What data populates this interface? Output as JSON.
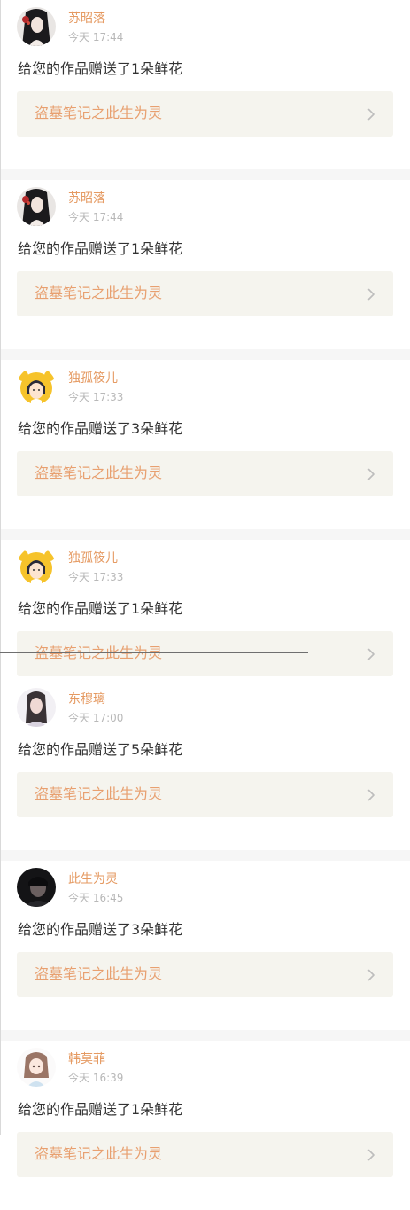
{
  "notifications": [
    {
      "user": "苏昭落",
      "time": "今天 17:44",
      "message": "给您的作品赠送了1朵鲜花",
      "work_title": "盗墓笔记之此生为灵",
      "avatar_icon": "avatar-icon-ink-portrait-woman"
    },
    {
      "user": "苏昭落",
      "time": "今天 17:44",
      "message": "给您的作品赠送了1朵鲜花",
      "work_title": "盗墓笔记之此生为灵",
      "avatar_icon": "avatar-icon-ink-portrait-woman"
    },
    {
      "user": "独孤筱儿",
      "time": "今天 17:33",
      "message": "给您的作品赠送了3朵鲜花",
      "work_title": "盗墓笔记之此生为灵",
      "avatar_icon": "avatar-icon-cartoon-girl-yellow"
    },
    {
      "user": "独孤筱儿",
      "time": "今天 17:33",
      "message": "给您的作品赠送了1朵鲜花",
      "work_title": "盗墓笔记之此生为灵",
      "avatar_icon": "avatar-icon-cartoon-girl-yellow"
    },
    {
      "user": "东穆璃",
      "time": "今天 17:00",
      "message": "给您的作品赠送了5朵鲜花",
      "work_title": "盗墓笔记之此生为灵",
      "avatar_icon": "avatar-icon-photo-woman"
    },
    {
      "user": "此生为灵",
      "time": "今天 16:45",
      "message": "给您的作品赠送了3朵鲜花",
      "work_title": "盗墓笔记之此生为灵",
      "avatar_icon": "avatar-icon-photo-man-dark"
    },
    {
      "user": "韩莫菲",
      "time": "今天 16:39",
      "message": "给您的作品赠送了1朵鲜花",
      "work_title": "盗墓笔记之此生为灵",
      "avatar_icon": "avatar-icon-anime-girl"
    }
  ],
  "colors": {
    "username": "#e59a62",
    "timestamp": "#b8b8b8",
    "message": "#333333",
    "work_title": "#e8a070",
    "work_background": "#f5f4ee",
    "separator": "#f6f6f6"
  },
  "chevron_icon": "chevron-right-icon"
}
